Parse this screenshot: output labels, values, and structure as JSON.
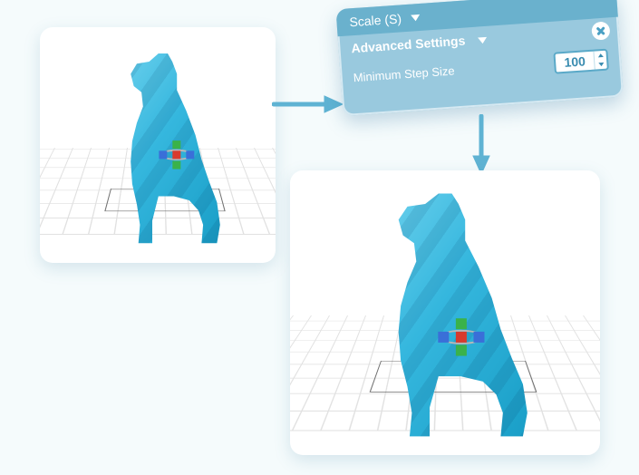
{
  "panel": {
    "header": "Scale (S)",
    "section": "Advanced Settings",
    "field": "Minimum Step Size",
    "value": "100"
  },
  "gizmo_axes": {
    "x": "blue",
    "y": "green",
    "z": "red"
  },
  "accent": "#5fb3d3"
}
